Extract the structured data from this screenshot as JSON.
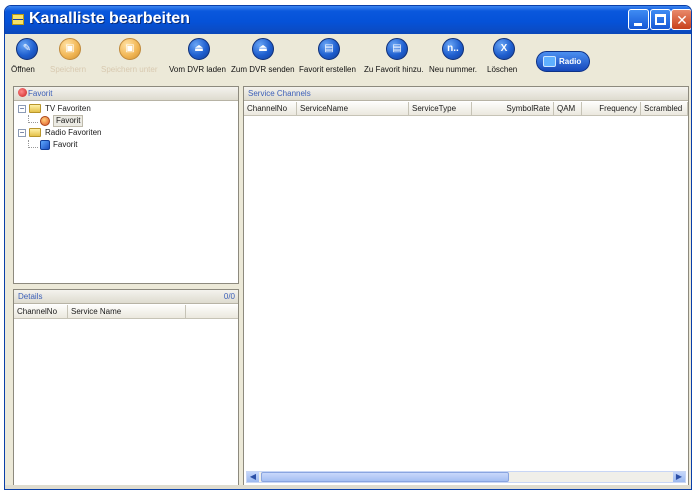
{
  "window": {
    "title": "Kanalliste bearbeiten"
  },
  "toolbar": {
    "open_label": "Öffnen",
    "save_label": "Speichern",
    "save_as_label": "Speichern unter",
    "load_dvr_label": "Vom DVR laden",
    "send_dvr_label": "Zum DVR senden",
    "create_fav_label": "Favorit erstellen",
    "add_fav_label": "Zu Favorit hinzu.",
    "renumber_label": "Neu nummer.",
    "renumber_icon_text": "n..",
    "delete_label": "Löschen",
    "delete_icon_text": "X",
    "radio_label": "Radio"
  },
  "favorit_panel": {
    "title": "Favorit",
    "tree": {
      "tv_group": "TV Favoriten",
      "tv_child": "Favorit",
      "radio_group": "Radio Favoriten",
      "radio_child": "Favorit"
    }
  },
  "details_panel": {
    "title": "Details",
    "count": "0/0",
    "columns": [
      "ChannelNo",
      "Service Name"
    ]
  },
  "channels_panel": {
    "title": "Service Channels",
    "columns": [
      "ChannelNo",
      "ServiceName",
      "ServiceType",
      "SymbolRate",
      "QAM",
      "Frequency",
      "Scrambled"
    ]
  },
  "colors": {
    "titlebar": "#0552d8",
    "panel_header_text": "#3c5fb8",
    "window_bg": "#ece9d8"
  }
}
